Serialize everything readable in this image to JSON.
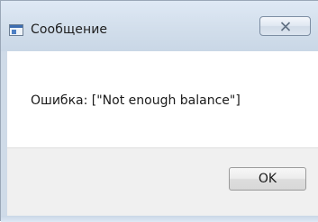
{
  "window": {
    "title": "Сообщение",
    "app_icon": "window-icon",
    "close_icon": "close-icon"
  },
  "body": {
    "message": "Ошибка: [\"Not enough balance\"]"
  },
  "buttons": {
    "ok_label": "OK"
  },
  "colors": {
    "frame": "#cfdbe8",
    "client": "#ffffff",
    "footer": "#f0f0f0"
  }
}
